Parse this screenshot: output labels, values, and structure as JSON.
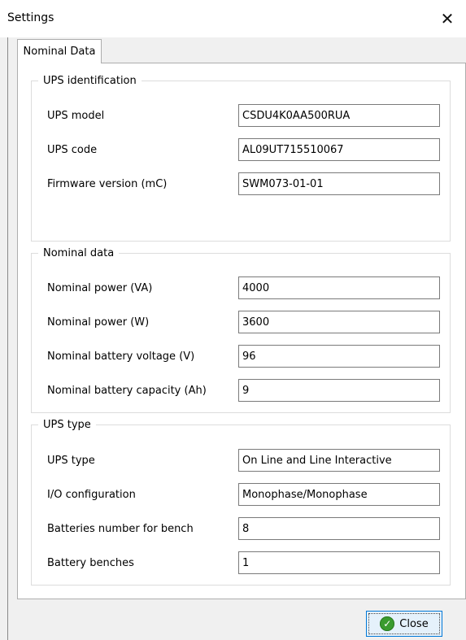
{
  "window": {
    "title": "Settings",
    "close_glyph": "✕"
  },
  "tabs": [
    {
      "label": "Nominal Data",
      "active": true
    }
  ],
  "groups": [
    {
      "legend": "UPS identification",
      "fields": [
        {
          "label": "UPS model",
          "value": "CSDU4K0AA500RUA"
        },
        {
          "label": "UPS code",
          "value": "AL09UT715510067"
        },
        {
          "label": "Firmware version (mC)",
          "value": "SWM073-01-01"
        }
      ]
    },
    {
      "legend": "Nominal data",
      "fields": [
        {
          "label": "Nominal power (VA)",
          "value": "4000"
        },
        {
          "label": "Nominal power (W)",
          "value": "3600"
        },
        {
          "label": "Nominal battery voltage (V)",
          "value": "96"
        },
        {
          "label": "Nominal battery capacity (Ah)",
          "value": "9"
        }
      ]
    },
    {
      "legend": "UPS type",
      "fields": [
        {
          "label": "UPS type",
          "value": "On Line and Line Interactive"
        },
        {
          "label": "I/O configuration",
          "value": "Monophase/Monophase"
        },
        {
          "label": "Batteries number for bench",
          "value": "8"
        },
        {
          "label": "Battery benches",
          "value": "1"
        }
      ]
    }
  ],
  "footer": {
    "close_label": "Close",
    "close_icon": "check-icon"
  },
  "colors": {
    "accent": "#0078d7",
    "check": "#3a9b2f"
  }
}
